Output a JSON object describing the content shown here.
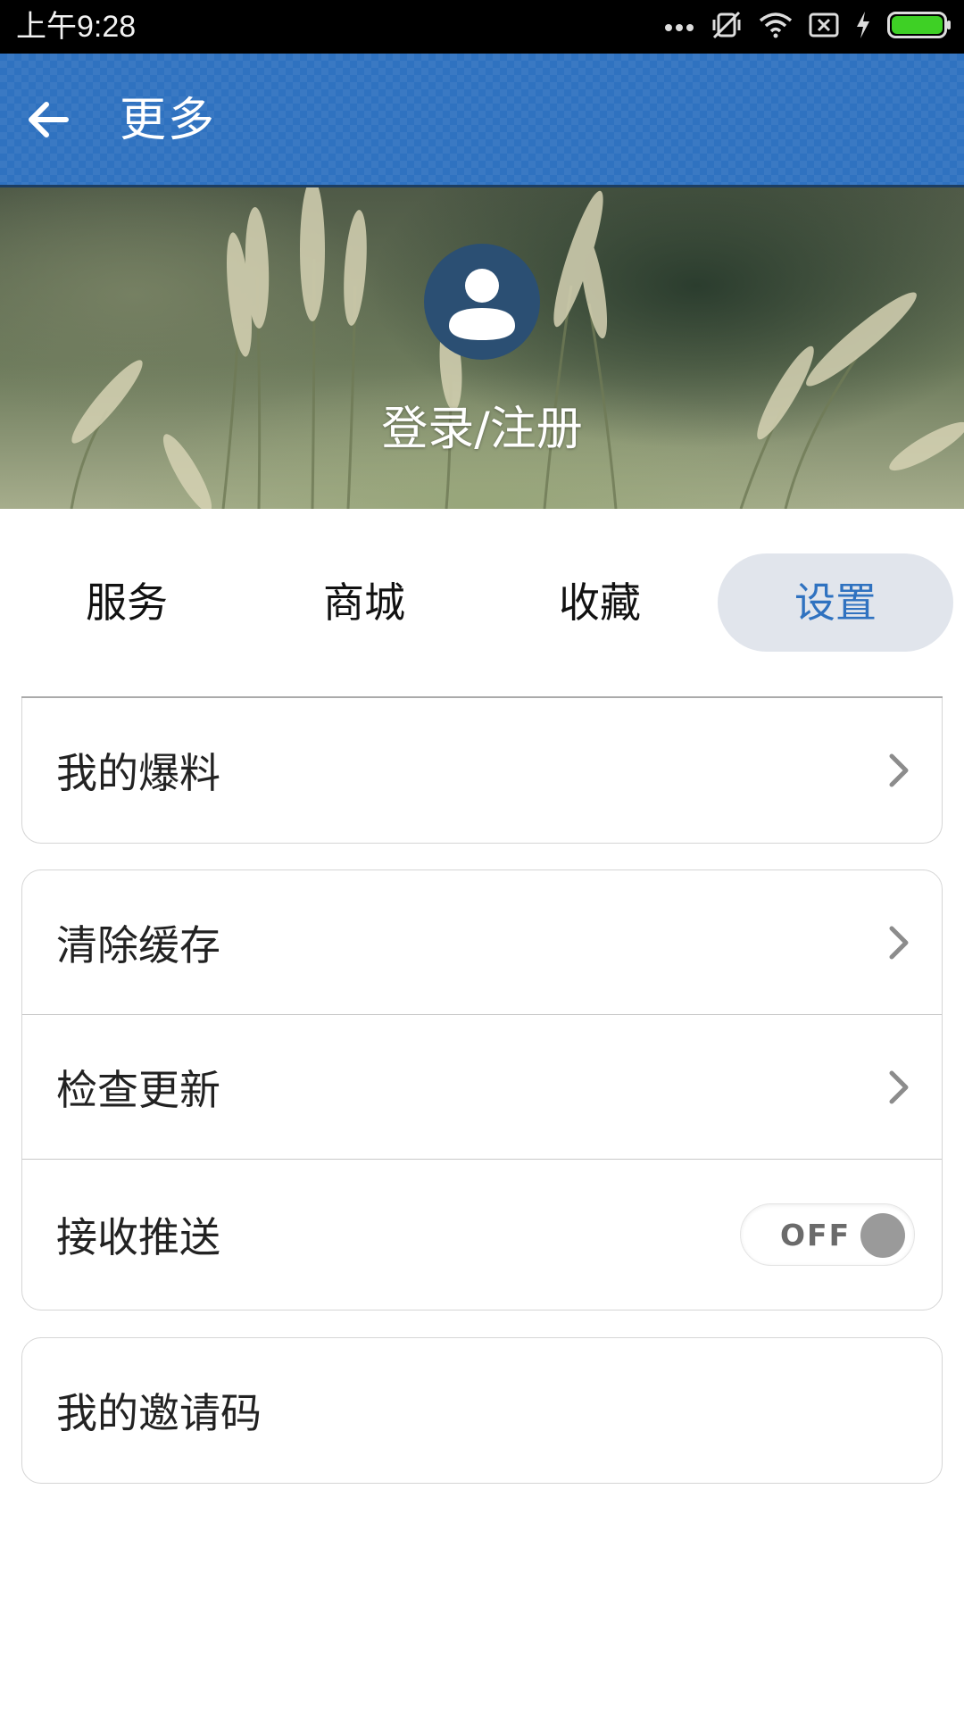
{
  "status_bar": {
    "time": "上午9:28",
    "icons": [
      "more-dots-icon",
      "vibrate-mute-icon",
      "wifi-icon",
      "no-sim-icon",
      "charging-bolt-icon",
      "battery-full-icon"
    ],
    "battery_color": "#3ed025"
  },
  "app_bar": {
    "title": "更多",
    "back_icon": "back-arrow-icon",
    "background": "#2f72c0"
  },
  "profile": {
    "avatar_icon": "user-avatar-icon",
    "login_label": "登录/注册"
  },
  "tabs": [
    {
      "label": "服务",
      "active": false
    },
    {
      "label": "商城",
      "active": false
    },
    {
      "label": "收藏",
      "active": false
    },
    {
      "label": "设置",
      "active": true
    }
  ],
  "groups": [
    {
      "items": [
        {
          "label": "我的爆料",
          "control": "chevron"
        }
      ]
    },
    {
      "items": [
        {
          "label": "清除缓存",
          "control": "chevron"
        },
        {
          "label": "检查更新",
          "control": "chevron"
        },
        {
          "label": "接收推送",
          "control": "toggle",
          "toggle_text": "OFF",
          "toggle_on": false
        }
      ]
    },
    {
      "items": [
        {
          "label": "我的邀请码",
          "control": "none"
        }
      ]
    }
  ],
  "accent_color": "#2f72c0"
}
